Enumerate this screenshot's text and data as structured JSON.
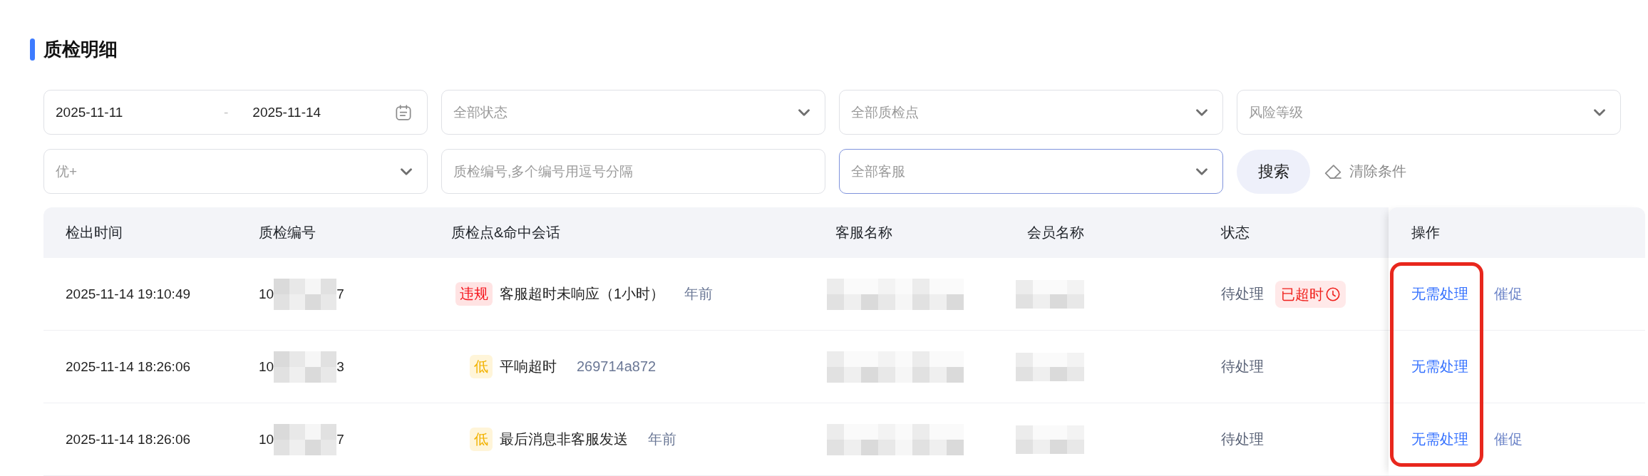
{
  "section": {
    "title": "质检明细"
  },
  "filters": [
    {
      "kind": "date_range",
      "start": "2025-11-11",
      "separator": "-",
      "end": "2025-11-14",
      "focused": false
    },
    {
      "kind": "select",
      "placeholder": "全部状态",
      "focused": false
    },
    {
      "kind": "select",
      "placeholder": "全部质检点",
      "focused": false
    },
    {
      "kind": "select",
      "placeholder": "风险等级",
      "focused": false
    },
    {
      "kind": "select",
      "placeholder": "优+",
      "focused": false
    },
    {
      "kind": "input",
      "placeholder": "质检编号,多个编号用逗号分隔",
      "focused": false
    },
    {
      "kind": "select",
      "placeholder": "全部客服",
      "focused": true
    }
  ],
  "search_button": {
    "label": "搜索"
  },
  "clear_button": {
    "label": "清除条件"
  },
  "table": {
    "columns": [
      "检出时间",
      "质检编号",
      "质检点&命中会话",
      "客服名称",
      "会员名称",
      "状态",
      "操作"
    ],
    "actions_highlighted": true,
    "rows": [
      {
        "detected_at": "2025-11-14 19:10:49",
        "inspection_id": {
          "start": "10",
          "end": "7",
          "redacted": true
        },
        "hit": {
          "tag": {
            "text": "违规",
            "kind": "violation"
          },
          "rule": "客服超时未响应（1小时）",
          "session": "年前"
        },
        "agent_redacted": true,
        "member_redacted": true,
        "status": "待处理",
        "overdue": {
          "text": "已超时"
        },
        "actions": [
          {
            "label": "无需处理",
            "kind": "primary"
          },
          {
            "label": "催促",
            "kind": "secondary"
          }
        ]
      },
      {
        "detected_at": "2025-11-14 18:26:06",
        "inspection_id": {
          "start": "10",
          "end": "3",
          "redacted": true
        },
        "hit": {
          "tag": {
            "text": "低",
            "kind": "low"
          },
          "rule": "平响超时",
          "session": "269714a872"
        },
        "agent_redacted": true,
        "member_redacted": true,
        "status": "待处理",
        "actions": [
          {
            "label": "无需处理",
            "kind": "primary"
          }
        ]
      },
      {
        "detected_at": "2025-11-14 18:26:06",
        "inspection_id": {
          "start": "10",
          "end": "7",
          "redacted": true
        },
        "hit": {
          "tag": {
            "text": "低",
            "kind": "low"
          },
          "rule": "最后消息非客服发送",
          "session": "年前"
        },
        "agent_redacted": true,
        "member_redacted": true,
        "status": "待处理",
        "actions": [
          {
            "label": "无需处理",
            "kind": "primary"
          },
          {
            "label": "催促",
            "kind": "secondary"
          }
        ]
      }
    ]
  }
}
